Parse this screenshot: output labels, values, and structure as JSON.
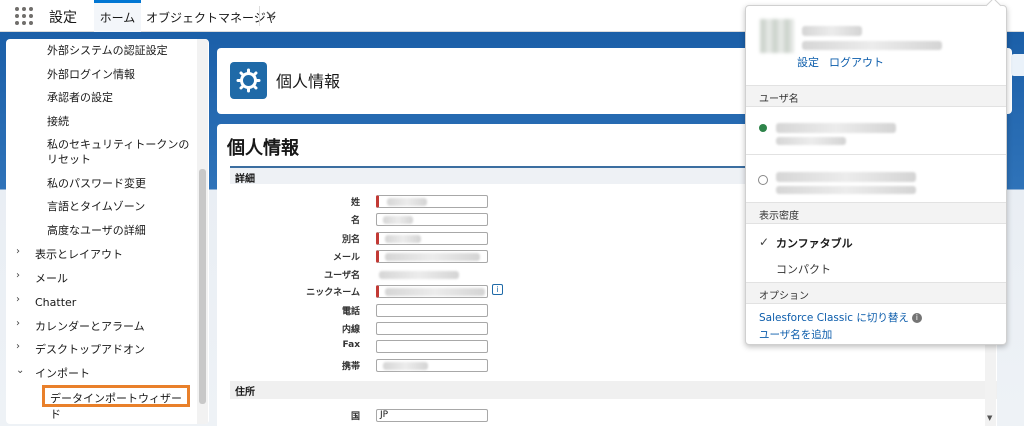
{
  "app": {
    "name": "設定"
  },
  "nav": {
    "home": "ホーム",
    "object_manager": "オブジェクトマネージャ"
  },
  "sidebar": {
    "sub_items": [
      "外部システムの認証設定",
      "外部ログイン情報",
      "承認者の設定",
      "接続",
      "私のセキュリティトークンのリセット",
      "私のパスワード変更",
      "言語とタイムゾーン",
      "高度なユーザの詳細"
    ],
    "top_items": [
      "表示とレイアウト",
      "メール",
      "Chatter",
      "カレンダーとアラーム",
      "デスクトップアドオン",
      "インポート"
    ],
    "import_child": "データインポートウィザード"
  },
  "header": {
    "title": "個人情報"
  },
  "main": {
    "title": "個人情報",
    "detail_section": "詳細",
    "address_section": "住所",
    "fields": [
      "姓",
      "名",
      "別名",
      "メール",
      "ユーザ名",
      "ニックネーム",
      "電話",
      "内線",
      "Fax",
      "携帯"
    ],
    "country_label": "国",
    "country_value": "JP"
  },
  "user_menu": {
    "settings_link": "設定",
    "logout_link": "ログアウト",
    "username_section": "ユーザ名",
    "density_section": "表示密度",
    "comfortable": "カンファタブル",
    "compact": "コンパクト",
    "options_section": "オプション",
    "switch_classic": "Salesforce Classic に切り替え",
    "add_username": "ユーザ名を追加"
  },
  "colors": {
    "accent": "#0176d3",
    "highlight": "#e9802a",
    "required": "#c23934"
  }
}
